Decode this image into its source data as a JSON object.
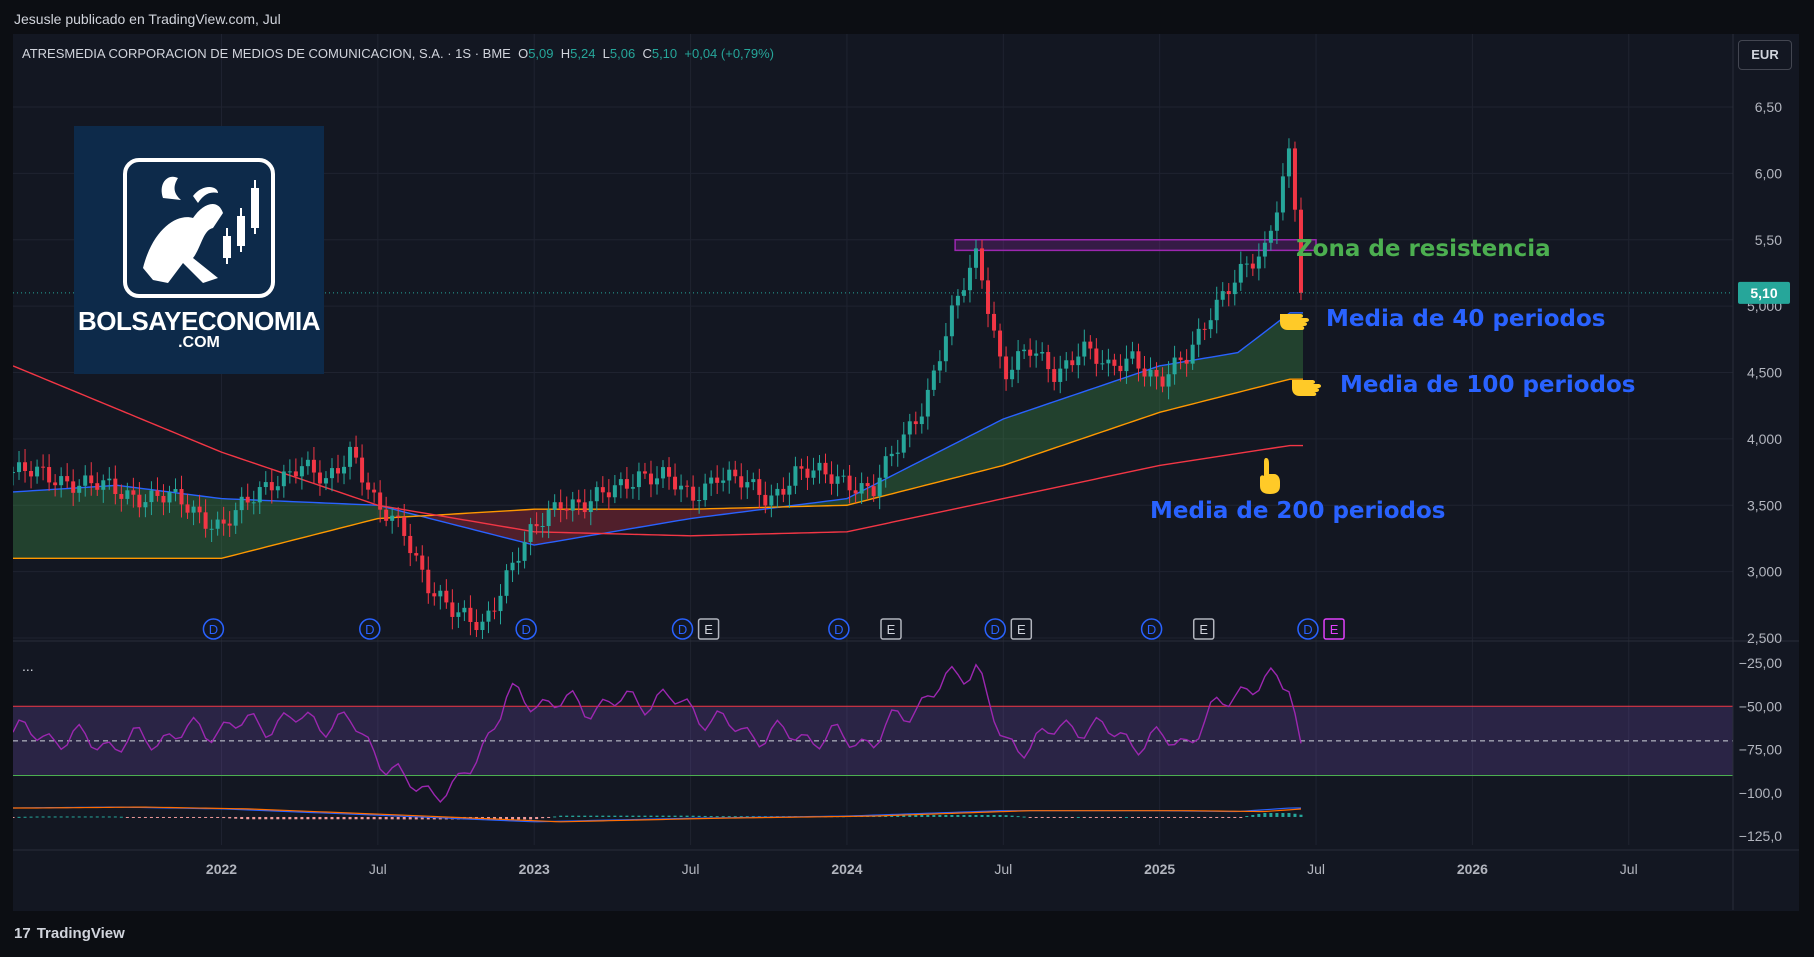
{
  "header": {
    "published": "Jesusle publicado en TradingView.com, Jul",
    "symbol": "ATRESMEDIA CORPORACION DE MEDIOS DE COMUNICACION, S.A.",
    "interval": "1S",
    "exchange": "BME",
    "open_label": "O",
    "open": "5,09",
    "high_label": "H",
    "high": "5,24",
    "low_label": "L",
    "low": "5,06",
    "close_label": "C",
    "close": "5,10",
    "change": "+0,04 (+0,79%)",
    "currency": "EUR"
  },
  "logo": {
    "name": "BOLSAYECONOMIA",
    "domain": ".COM"
  },
  "annotations": {
    "resistance": "Zona de resistencia",
    "ma40": "Media de 40 periodos",
    "ma100": "Media de 100 periodos",
    "ma200": "Media de 200 periodos"
  },
  "footer": {
    "brand": "TradingView",
    "mark": "17"
  },
  "indicator_menu": "...",
  "colors": {
    "up": "#26a69a",
    "down": "#f23645",
    "ma40": "#2962ff",
    "ma100": "#ff9800",
    "ma200": "#f23645",
    "rsi": "#9c27b0",
    "resistance": "#9c27b0"
  },
  "chart_data": [
    {
      "type": "candlestick",
      "title": "ATRESMEDIA CORPORACION DE MEDIOS DE COMUNICACION, S.A. · 1S · BME",
      "ylim": [
        2.5,
        6.75
      ],
      "y_ticks": [
        "6,50",
        "6,00",
        "5,50",
        "5,000",
        "4,500",
        "4,000",
        "3,500",
        "3,000",
        "2,500"
      ],
      "y_tick_values": [
        6.5,
        6.0,
        5.5,
        5.0,
        4.5,
        4.0,
        3.5,
        3.0,
        2.5
      ],
      "x_ticks": [
        "2022",
        "Jul",
        "2023",
        "Jul",
        "2024",
        "Jul",
        "2025",
        "Jul",
        "2026",
        "Jul"
      ],
      "x_tick_dates": [
        "2022-01",
        "2022-07",
        "2023-01",
        "2023-07",
        "2024-01",
        "2024-07",
        "2025-01",
        "2025-07",
        "2026-01",
        "2026-07"
      ],
      "xlim": [
        "2021-05",
        "2026-11"
      ],
      "last_price": "5,10",
      "last_value": 5.1,
      "resistance_zone": [
        5.42,
        5.5
      ],
      "resistance_dates": [
        "2024-04",
        "2025-07"
      ],
      "price_path": [
        [
          "2021-05",
          3.75
        ],
        [
          "2021-07",
          3.7
        ],
        [
          "2021-09",
          3.6
        ],
        [
          "2021-11",
          3.55
        ],
        [
          "2022-01",
          3.35
        ],
        [
          "2022-02",
          3.5
        ],
        [
          "2022-03",
          3.7
        ],
        [
          "2022-04",
          3.8
        ],
        [
          "2022-05",
          3.65
        ],
        [
          "2022-06",
          3.95
        ],
        [
          "2022-07",
          3.45
        ],
        [
          "2022-08",
          3.3
        ],
        [
          "2022-09",
          2.9
        ],
        [
          "2022-10",
          2.65
        ],
        [
          "2022-11",
          2.6
        ],
        [
          "2022-12",
          3.0
        ],
        [
          "2023-01",
          3.3
        ],
        [
          "2023-02",
          3.55
        ],
        [
          "2023-03",
          3.5
        ],
        [
          "2023-04",
          3.6
        ],
        [
          "2023-05",
          3.75
        ],
        [
          "2023-06",
          3.7
        ],
        [
          "2023-07",
          3.55
        ],
        [
          "2023-08",
          3.75
        ],
        [
          "2023-09",
          3.65
        ],
        [
          "2023-10",
          3.55
        ],
        [
          "2023-11",
          3.75
        ],
        [
          "2023-12",
          3.72
        ],
        [
          "2024-01",
          3.7
        ],
        [
          "2024-02",
          3.6
        ],
        [
          "2024-03",
          3.95
        ],
        [
          "2024-04",
          4.3
        ],
        [
          "2024-05",
          4.9
        ],
        [
          "2024-06",
          5.4
        ],
        [
          "2024-07",
          4.5
        ],
        [
          "2024-08",
          4.65
        ],
        [
          "2024-09",
          4.5
        ],
        [
          "2024-10",
          4.7
        ],
        [
          "2024-11",
          4.5
        ],
        [
          "2024-12",
          4.65
        ],
        [
          "2025-01",
          4.4
        ],
        [
          "2025-02",
          4.6
        ],
        [
          "2025-03",
          5.0
        ],
        [
          "2025-04",
          5.2
        ],
        [
          "2025-05",
          5.4
        ],
        [
          "2025-06",
          6.2
        ],
        [
          "2025-06b",
          5.1
        ]
      ],
      "series": [
        {
          "name": "Media de 40 periodos",
          "values": [
            [
              "2021-05",
              3.6
            ],
            [
              "2021-09",
              3.65
            ],
            [
              "2022-01",
              3.55
            ],
            [
              "2022-07",
              3.5
            ],
            [
              "2023-01",
              3.2
            ],
            [
              "2023-07",
              3.4
            ],
            [
              "2024-01",
              3.55
            ],
            [
              "2024-07",
              4.15
            ],
            [
              "2025-01",
              4.55
            ],
            [
              "2025-04",
              4.65
            ],
            [
              "2025-06",
              4.95
            ]
          ]
        },
        {
          "name": "Media de 100 periodos",
          "values": [
            [
              "2021-05",
              3.1
            ],
            [
              "2022-01",
              3.1
            ],
            [
              "2022-07",
              3.4
            ],
            [
              "2023-01",
              3.47
            ],
            [
              "2023-07",
              3.47
            ],
            [
              "2024-01",
              3.5
            ],
            [
              "2024-07",
              3.8
            ],
            [
              "2025-01",
              4.2
            ],
            [
              "2025-06",
              4.45
            ]
          ]
        },
        {
          "name": "Media de 200 periodos",
          "values": [
            [
              "2021-05",
              4.55
            ],
            [
              "2022-01",
              3.9
            ],
            [
              "2022-07",
              3.5
            ],
            [
              "2023-01",
              3.3
            ],
            [
              "2023-07",
              3.27
            ],
            [
              "2024-01",
              3.3
            ],
            [
              "2024-07",
              3.55
            ],
            [
              "2025-01",
              3.8
            ],
            [
              "2025-06",
              3.95
            ]
          ]
        }
      ],
      "event_markers": [
        {
          "date": "2021-12",
          "label": "D"
        },
        {
          "date": "2022-06",
          "label": "D"
        },
        {
          "date": "2022-12",
          "label": "D"
        },
        {
          "date": "2023-06",
          "label": "D"
        },
        {
          "date": "2023-07",
          "label": "E"
        },
        {
          "date": "2023-12",
          "label": "D"
        },
        {
          "date": "2024-02",
          "label": "E"
        },
        {
          "date": "2024-06",
          "label": "D"
        },
        {
          "date": "2024-07",
          "label": "E"
        },
        {
          "date": "2024-12",
          "label": "D"
        },
        {
          "date": "2025-02",
          "label": "E"
        },
        {
          "date": "2025-06",
          "label": "D"
        },
        {
          "date": "2025-07",
          "label": "E"
        }
      ]
    },
    {
      "type": "line",
      "title": "",
      "ylim": [
        -130,
        -22
      ],
      "y_ticks": [
        "−25,00",
        "−50,00",
        "−75,00",
        "−100,0",
        "−125,0"
      ],
      "y_tick_values": [
        -25,
        -50,
        -75,
        -100,
        -125
      ],
      "band": [
        -50,
        -90
      ],
      "midline": -70,
      "series": [
        {
          "name": "",
          "values": [
            [
              "2021-05",
              -65
            ],
            [
              "2021-09",
              -72
            ],
            [
              "2022-01",
              -62
            ],
            [
              "2022-04",
              -58
            ],
            [
              "2022-06",
              -60
            ],
            [
              "2022-08",
              -95
            ],
            [
              "2022-10",
              -100
            ],
            [
              "2022-12",
              -45
            ],
            [
              "2023-03",
              -50
            ],
            [
              "2023-06",
              -45
            ],
            [
              "2023-09",
              -65
            ],
            [
              "2023-12",
              -68
            ],
            [
              "2024-02",
              -70
            ],
            [
              "2024-04",
              -45
            ],
            [
              "2024-06",
              -25
            ],
            [
              "2024-07",
              -75
            ],
            [
              "2024-10",
              -60
            ],
            [
              "2024-12",
              -70
            ],
            [
              "2025-02",
              -70
            ],
            [
              "2025-04",
              -40
            ],
            [
              "2025-06",
              -35
            ],
            [
              "2025-06b",
              -80
            ]
          ]
        }
      ]
    }
  ]
}
